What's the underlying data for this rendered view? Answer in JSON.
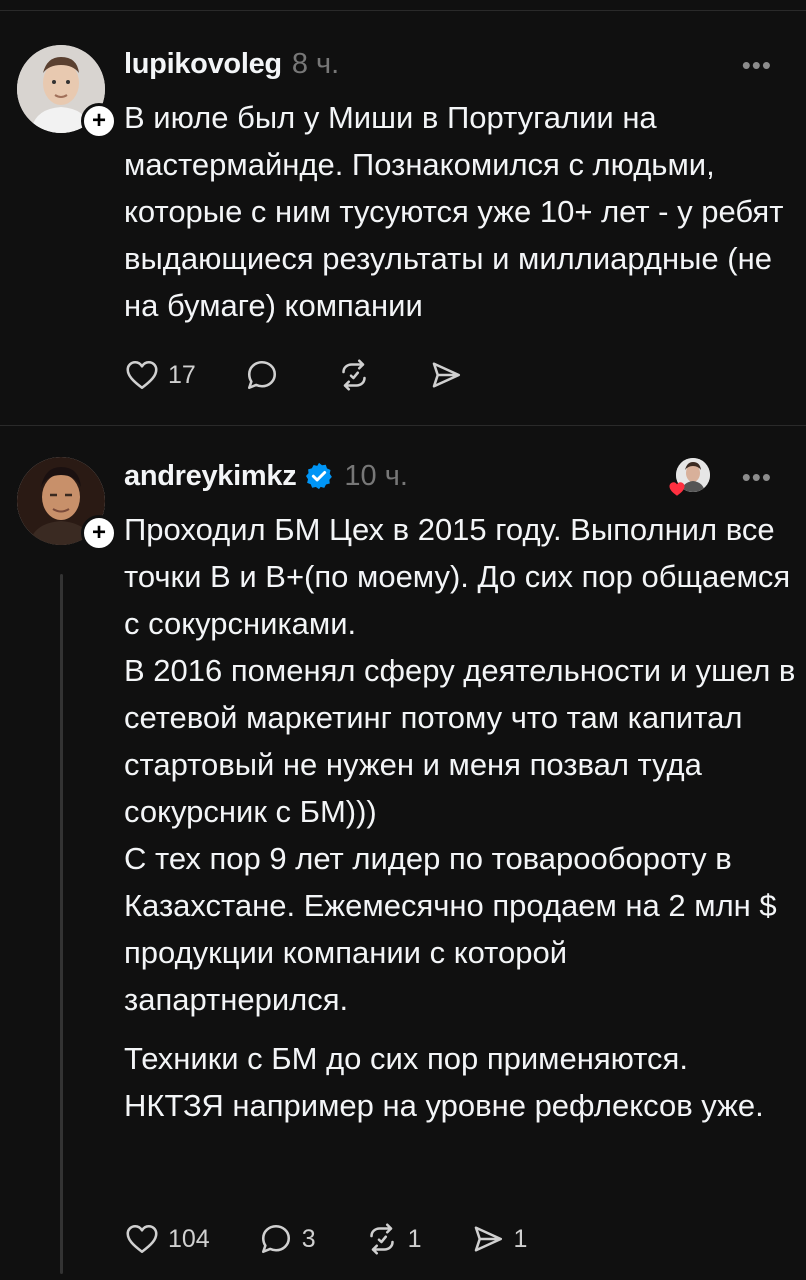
{
  "posts": [
    {
      "username": "lupikovoleg",
      "time": "8 ч.",
      "verified": false,
      "text_paragraphs": [
        "В июле был у Миши в Португалии на мастермайнде. Познакомился с людьми, которые с ним тусуются уже 10+ лет - у ребят выдающиеся результаты и миллиардные (не на бумаге) компании"
      ],
      "actions": {
        "likes": "17",
        "replies": "",
        "reposts": "",
        "shares": ""
      }
    },
    {
      "username": "andreykimkz",
      "time": "10 ч.",
      "verified": true,
      "text_paragraphs": [
        "Проходил БМ Цех в 2015 году. Выполнил все точки B и B+(по моему). До сих пор общаемся с сокурсниками.\nВ 2016 поменял сферу деятельности и ушел в сетевой маркетинг потому что там капитал стартовый не нужен и меня позвал туда сокурсник с БМ)))\nС тех пор 9 лет лидер по товарообороту в Казахстане. Ежемесячно продаем на 2 млн $ продукции компании с которой запартнерился.",
        "Техники с БМ до сих пор применяются. НКТЗЯ например на уровне рефлексов уже."
      ],
      "actions": {
        "likes": "104",
        "replies": "3",
        "reposts": "1",
        "shares": "1"
      }
    }
  ],
  "colors": {
    "background": "#101010",
    "text": "#f3f5f7",
    "muted": "#777777",
    "verified": "#0095f6",
    "heart": "#ff3040"
  },
  "icons": {
    "follow_badge": "+",
    "more": "•••"
  }
}
